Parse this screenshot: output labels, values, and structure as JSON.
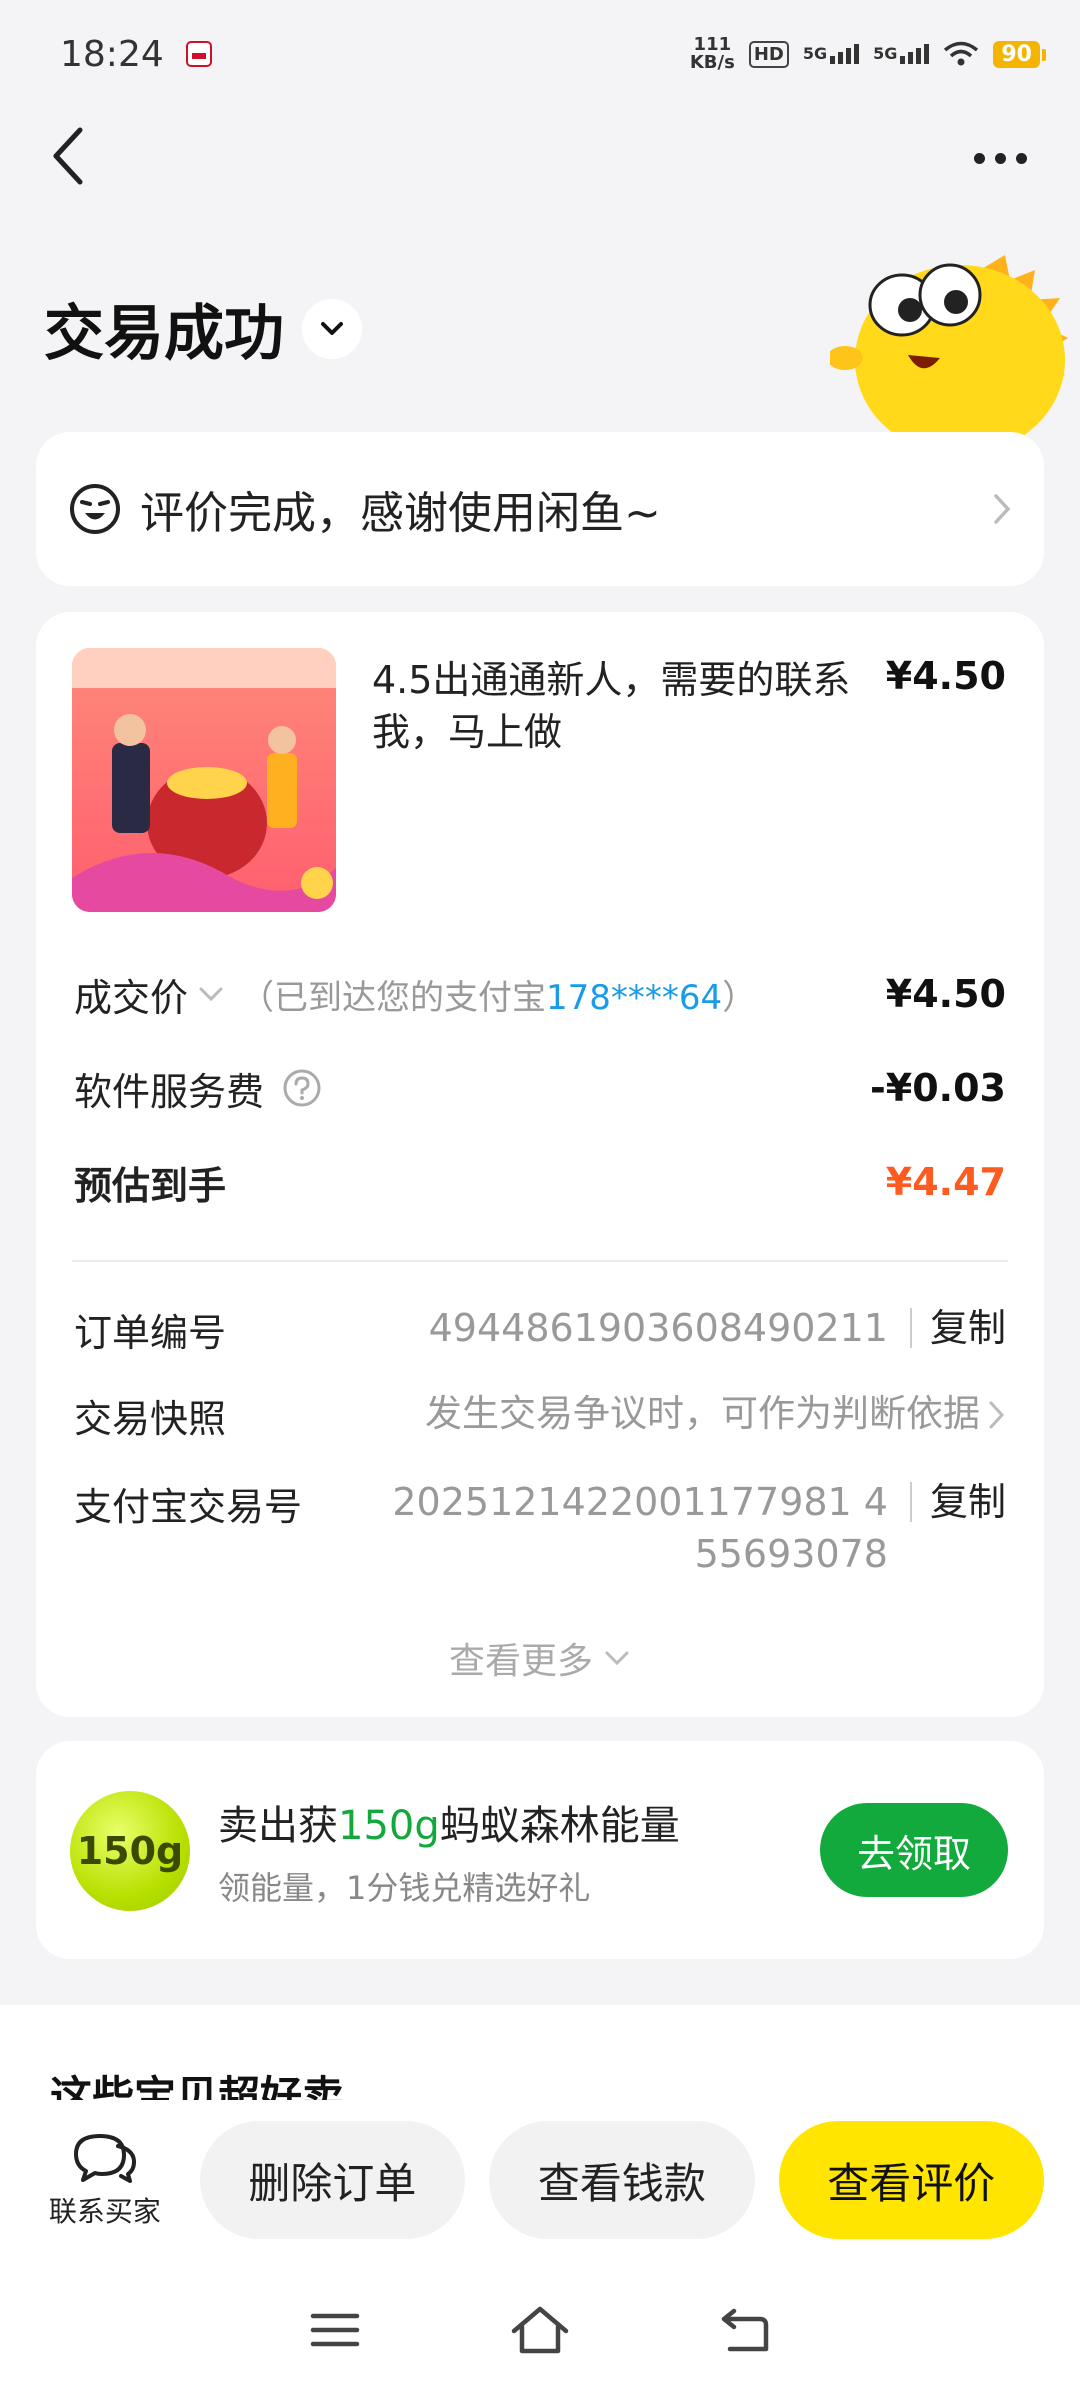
{
  "status_bar": {
    "time": "18:24",
    "net_speed_value": "111",
    "net_speed_unit": "KB/s",
    "hd_label": "HD",
    "sim1_label": "5G",
    "sim2_label": "5G",
    "battery": "90"
  },
  "page": {
    "title": "交易成功"
  },
  "review_banner": {
    "text": "评价完成，感谢使用闲鱼~"
  },
  "goods": {
    "title": "4.5出通通新人，需要的联系我，马上做",
    "price": "¥4.50"
  },
  "price_rows": {
    "deal_label": "成交价",
    "deal_note_prefix": "（已到达您的支付宝",
    "deal_note_account": "178****64",
    "deal_note_suffix": "）",
    "deal_value": "¥4.50",
    "fee_label": "软件服务费",
    "fee_value": "-¥0.03",
    "estimate_label": "预估到手",
    "estimate_value": "¥4.47"
  },
  "order_info": {
    "order_no_label": "订单编号",
    "order_no": "4944861903608490211",
    "copy_label": "复制",
    "snapshot_label": "交易快照",
    "snapshot_value": "发生交易争议时，可作为判断依据",
    "alipay_no_label": "支付宝交易号",
    "alipay_no_line1": "2025121422001177981 4",
    "alipay_no_line2": "55693078",
    "see_more": "查看更多"
  },
  "energy": {
    "ball_label": "150g",
    "title_prefix": "卖出获",
    "title_highlight": "150g",
    "title_suffix": "蚂蚁森林能量",
    "subtitle": "领能量，1分钱兑精选好礼",
    "claim_button": "去领取"
  },
  "recommend": {
    "title": "这些宝贝超好卖"
  },
  "actions": {
    "contact_label": "联系买家",
    "delete_label": "删除订单",
    "money_label": "查看钱款",
    "review_label": "查看评价"
  },
  "colors": {
    "accent_yellow": "#ffe500",
    "price_orange": "#ff5a1f",
    "green": "#12aa3c",
    "link_blue": "#1a9be8"
  }
}
